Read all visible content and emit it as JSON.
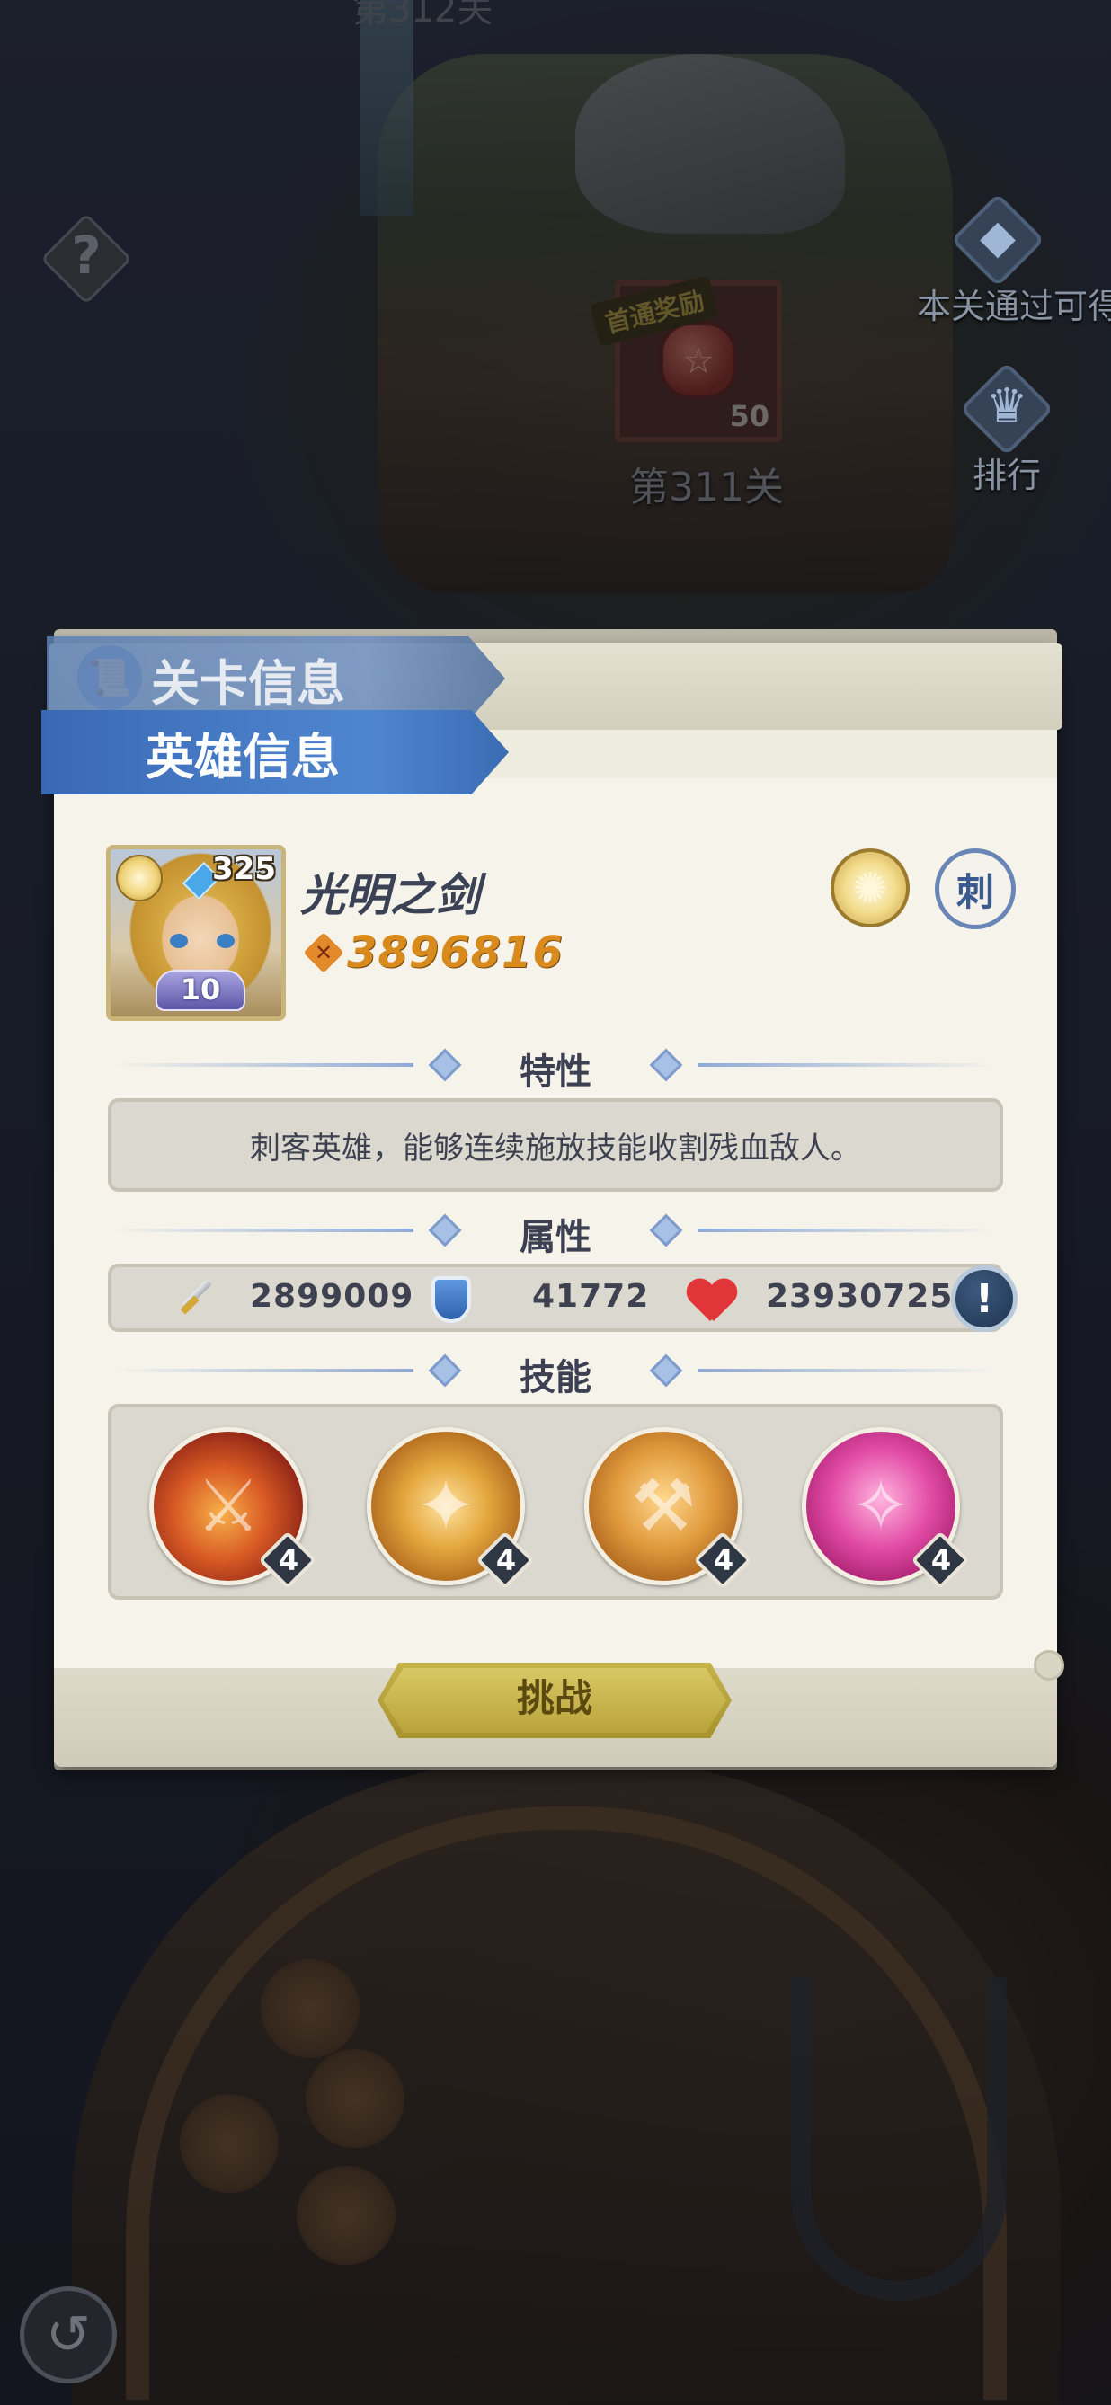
{
  "background": {
    "stage_prev_label": "第312关",
    "stage_label": "第311关",
    "reward_tag": "首通奖励",
    "reward_count": "50",
    "right_buttons": [
      {
        "icon": "diamond-icon",
        "label": "本关通过可得"
      },
      {
        "icon": "trophy-icon",
        "label": "排行"
      }
    ],
    "help_icon": "?"
  },
  "tabs": {
    "stage_info": "关卡信息",
    "hero_info": "英雄信息"
  },
  "hero": {
    "name": "光明之剑",
    "level": "325",
    "stars": "10",
    "power": "3896816",
    "element_icon": "sun-icon",
    "class_badge": "刺"
  },
  "sections": {
    "trait_title": "特性",
    "trait_text": "刺客英雄，能够连续施放技能收割残血敌人。",
    "attr_title": "属性",
    "skill_title": "技能"
  },
  "stats": {
    "attack": "2899009",
    "defense": "41772",
    "hp": "23930725"
  },
  "skills": [
    {
      "level": "4"
    },
    {
      "level": "4"
    },
    {
      "level": "4"
    },
    {
      "level": "4"
    }
  ],
  "actions": {
    "challenge": "挑战"
  },
  "colors": {
    "tab_active": "#3a69b4",
    "power": "#d88b1c",
    "challenge": "#c6b34a"
  }
}
